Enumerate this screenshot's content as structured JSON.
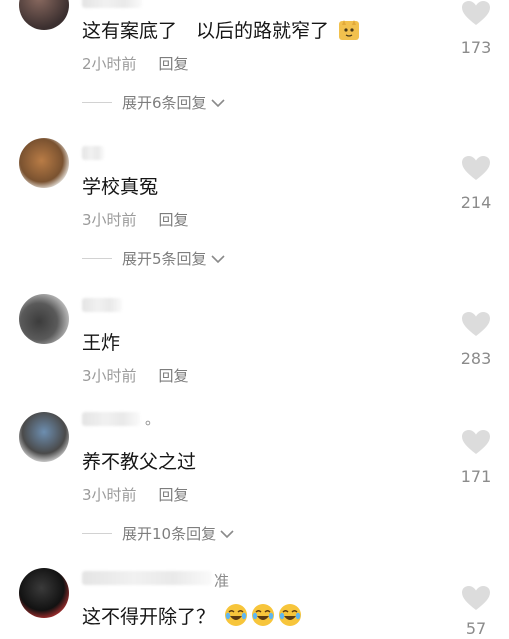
{
  "comments": [
    {
      "text": "这有案底了　以后的路就窄了",
      "time": "2小时前",
      "reply_label": "回复",
      "expand_label": "展开6条回复",
      "likes": "173"
    },
    {
      "text": "学校真冤",
      "time": "3小时前",
      "reply_label": "回复",
      "expand_label": "展开5条回复",
      "likes": "214"
    },
    {
      "text": "王炸",
      "time": "3小时前",
      "reply_label": "回复",
      "likes": "283"
    },
    {
      "name_suffix": "。",
      "text": "养不教父之过",
      "time": "3小时前",
      "reply_label": "回复",
      "expand_label": "展开10条回复",
      "likes": "171"
    },
    {
      "name_suffix": "准",
      "text": "这不得开除了？",
      "likes": "57"
    }
  ],
  "icons": {
    "like": "heart-icon",
    "expand": "chevron-down-icon",
    "emoji": "laughing-crying-emoji",
    "sticker": "cat-emoji"
  },
  "colors": {
    "text": "#161616",
    "meta": "#9b9b9b",
    "heart": "#dcdcdc"
  }
}
